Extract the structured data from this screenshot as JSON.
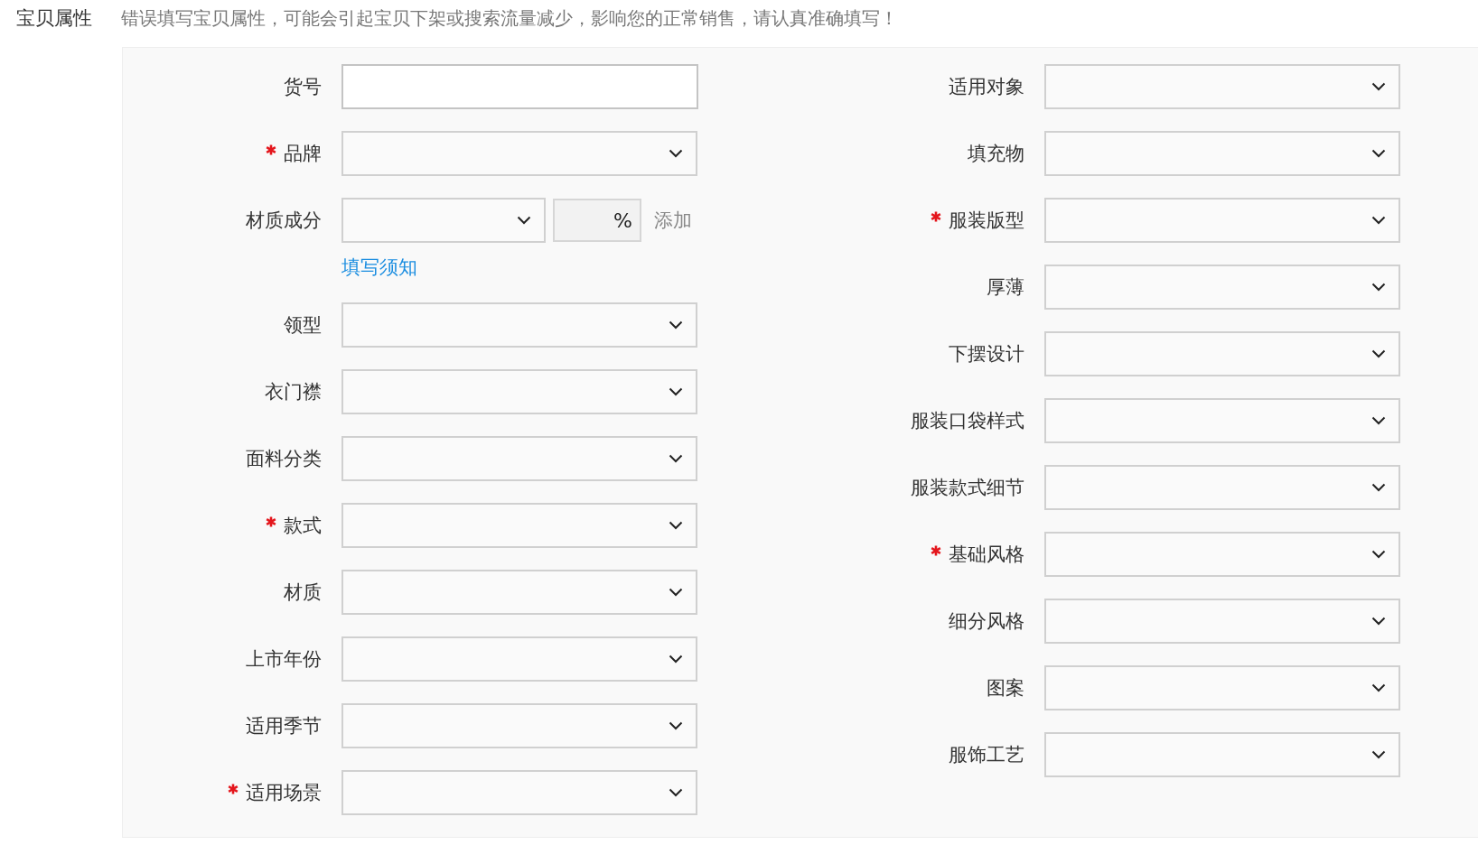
{
  "section": {
    "title": "宝贝属性",
    "notice": "错误填写宝贝属性，可能会引起宝贝下架或搜索流量减少，影响您的正常销售，请认真准确填写！"
  },
  "left_fields": [
    {
      "label": "货号",
      "kind": "text",
      "required": false
    },
    {
      "label": "品牌",
      "kind": "select",
      "required": true
    },
    {
      "label": "材质成分",
      "kind": "composition",
      "required": false,
      "unit": "%",
      "action": "添加",
      "link": "填写须知"
    },
    {
      "label": "领型",
      "kind": "select",
      "required": false
    },
    {
      "label": "衣门襟",
      "kind": "select",
      "required": false
    },
    {
      "label": "面料分类",
      "kind": "select",
      "required": false
    },
    {
      "label": "款式",
      "kind": "select",
      "required": true
    },
    {
      "label": "材质",
      "kind": "select",
      "required": false
    },
    {
      "label": "上市年份",
      "kind": "select",
      "required": false
    },
    {
      "label": "适用季节",
      "kind": "select",
      "required": false
    },
    {
      "label": "适用场景",
      "kind": "select",
      "required": true
    }
  ],
  "right_fields": [
    {
      "label": "适用对象",
      "kind": "select",
      "required": false
    },
    {
      "label": "填充物",
      "kind": "select",
      "required": false
    },
    {
      "label": "服装版型",
      "kind": "select",
      "required": true
    },
    {
      "label": "厚薄",
      "kind": "select",
      "required": false
    },
    {
      "label": "下摆设计",
      "kind": "select",
      "required": false
    },
    {
      "label": "服装口袋样式",
      "kind": "select",
      "required": false
    },
    {
      "label": "服装款式细节",
      "kind": "select",
      "required": false
    },
    {
      "label": "基础风格",
      "kind": "select",
      "required": true
    },
    {
      "label": "细分风格",
      "kind": "select",
      "required": false
    },
    {
      "label": "图案",
      "kind": "select",
      "required": false
    },
    {
      "label": "服饰工艺",
      "kind": "select",
      "required": false
    }
  ]
}
